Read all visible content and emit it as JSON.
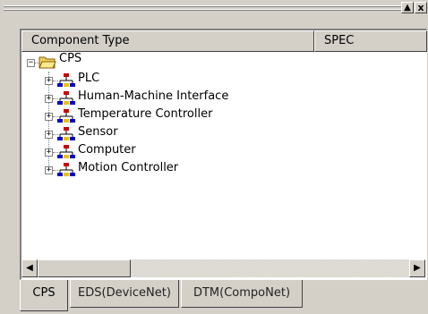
{
  "titlebar": {
    "up_glyph": "▲",
    "close_glyph": "x"
  },
  "columns": {
    "type": "Component Type",
    "spec": "SPEC"
  },
  "tree": {
    "root": {
      "label": "CPS",
      "icon": "folder-open-icon",
      "expanded": true
    },
    "children": [
      {
        "label": "PLC",
        "icon": "network-device-icon",
        "expanded": false
      },
      {
        "label": "Human-Machine Interface",
        "icon": "network-device-icon",
        "expanded": false
      },
      {
        "label": "Temperature Controller",
        "icon": "network-device-icon",
        "expanded": false
      },
      {
        "label": "Sensor",
        "icon": "network-device-icon",
        "expanded": false
      },
      {
        "label": "Computer",
        "icon": "network-device-icon",
        "expanded": false
      },
      {
        "label": "Motion Controller",
        "icon": "network-device-icon",
        "expanded": false
      }
    ]
  },
  "scrollbar": {
    "left_glyph": "◀",
    "right_glyph": "▶"
  },
  "tabs": [
    {
      "label": "CPS",
      "active": true
    },
    {
      "label": "EDS(DeviceNet)",
      "active": false
    },
    {
      "label": "DTM(CompoNet)",
      "active": false
    }
  ],
  "colors": {
    "panel": "#d4d0c8",
    "icon_red": "#cc0000",
    "icon_blue": "#0000cc",
    "icon_yellow": "#f0c000"
  }
}
